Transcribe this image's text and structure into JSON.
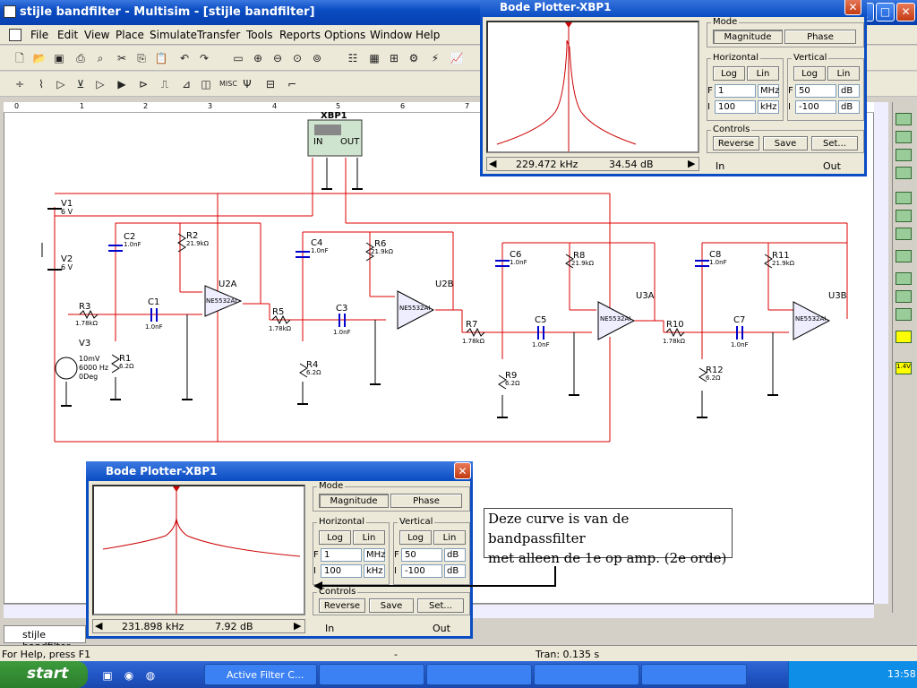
{
  "window": {
    "title": "stijle bandfilter - Multisim - [stijle bandfilter]",
    "min": "_",
    "max": "□",
    "close": "✕"
  },
  "menu": [
    "File",
    "Edit",
    "View",
    "Place",
    "Simulate",
    "Transfer",
    "Tools",
    "Reports",
    "Options",
    "Window",
    "Help"
  ],
  "ruler": [
    "0",
    "1",
    "2",
    "3",
    "4",
    "5",
    "6",
    "7"
  ],
  "components": {
    "xbp1": "XBP1",
    "in": "IN",
    "out": "OUT",
    "v1": "V1",
    "v1v": "6 V",
    "v2": "V2",
    "v2v": "6 V",
    "v3": "V3",
    "v3a": "10mV",
    "v3b": "6000 Hz",
    "v3c": "0Deg",
    "r1": "R1",
    "r1v": "6.2Ω",
    "r2": "R2",
    "r2v": "21.9kΩ",
    "r3": "R3",
    "r3v": "1.78kΩ",
    "r4": "R4",
    "r4v": "6.2Ω",
    "r5": "R5",
    "r5v": "1.78kΩ",
    "r6": "R6",
    "r6v": "21.9kΩ",
    "r7": "R7",
    "r7v": "1.78kΩ",
    "r8": "R8",
    "r8v": "21.9kΩ",
    "r9": "R9",
    "r9v": "6.2Ω",
    "r10": "R10",
    "r10v": "1.78kΩ",
    "r11": "R11",
    "r11v": "21.9kΩ",
    "r12": "R12",
    "r12v": "6.2Ω",
    "c1": "C1",
    "c1v": "1.0nF",
    "c2": "C2",
    "c2v": "1.0nF",
    "c3": "C3",
    "c3v": "1.0nF",
    "c4": "C4",
    "c4v": "1.0nF",
    "c5": "C5",
    "c5v": "1.0nF",
    "c6": "C6",
    "c6v": "1.0nF",
    "c7": "C7",
    "c7v": "1.0nF",
    "c8": "C8",
    "c8v": "1.0nF",
    "u2a": "U2A",
    "u2b": "U2B",
    "u3a": "U3A",
    "u3b": "U3B",
    "opamp": "NE5532AI"
  },
  "bode_top": {
    "title": "Bode Plotter-XBP1",
    "mode": "Mode",
    "magnitude": "Magnitude",
    "phase": "Phase",
    "horizontal": "Horizontal",
    "vertical": "Vertical",
    "log": "Log",
    "lin": "Lin",
    "hF": "1",
    "hFunit": "MHz",
    "hI": "100",
    "hIunit": "kHz",
    "vF": "50",
    "vFunit": "dB",
    "vI": "-100",
    "vIunit": "dB",
    "controls": "Controls",
    "reverse": "Reverse",
    "save": "Save",
    "set": "Set...",
    "freq": "229.472 kHz",
    "db": "34.54 dB",
    "inlbl": "In",
    "outlbl": "Out",
    "F": "F",
    "I": "I"
  },
  "bode_bottom": {
    "title": "Bode Plotter-XBP1",
    "mode": "Mode",
    "magnitude": "Magnitude",
    "phase": "Phase",
    "horizontal": "Horizontal",
    "vertical": "Vertical",
    "log": "Log",
    "lin": "Lin",
    "hF": "1",
    "hFunit": "MHz",
    "hI": "100",
    "hIunit": "kHz",
    "vF": "50",
    "vFunit": "dB",
    "vI": "-100",
    "vIunit": "dB",
    "controls": "Controls",
    "reverse": "Reverse",
    "save": "Save",
    "set": "Set...",
    "freq": "231.898 kHz",
    "db": "7.92 dB",
    "inlbl": "In",
    "outlbl": "Out",
    "F": "F",
    "I": "I"
  },
  "annotation": {
    "line1": "Deze curve is van de bandpassfilter",
    "line2": "met alleen de 1e op amp. (2e orde)"
  },
  "tab": "stijle bandfilter",
  "status": {
    "help": "For Help, press F1",
    "dash": "-",
    "tran": "Tran: 0.135 s"
  },
  "taskbar": {
    "start": "start",
    "task1": "Active Filter C...",
    "clock": "13:58"
  },
  "rightbar": {
    "probe": "1.4V"
  }
}
